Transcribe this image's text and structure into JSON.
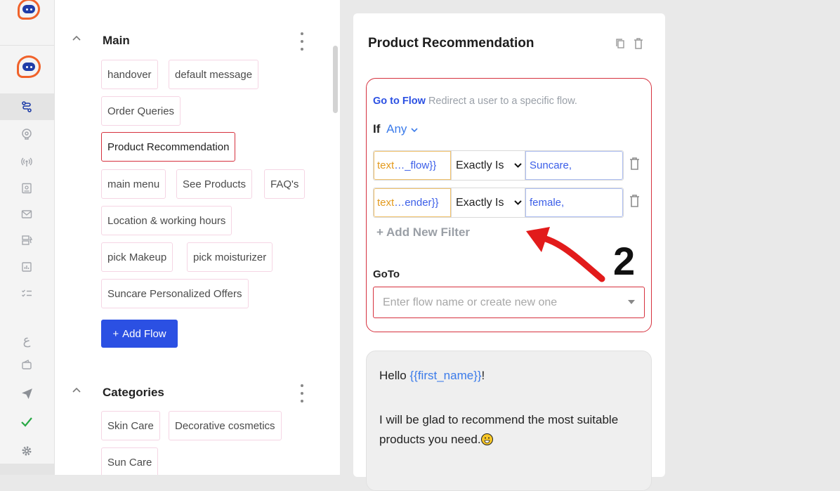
{
  "rail": {
    "items": [
      "logo-icon",
      "flows-icon",
      "brain-icon",
      "broadcast-icon",
      "contacts-icon",
      "mail-icon",
      "templates-icon",
      "analytics-icon",
      "checklist-icon",
      "arabic-icon",
      "wallet-icon",
      "send-icon",
      "check-icon",
      "settings-icon"
    ],
    "arabic_glyph": "ع"
  },
  "groups": [
    {
      "title": "Main",
      "chips": [
        "handover",
        "default message",
        "Order Queries",
        "Product Recommendation",
        "main menu",
        "See Products",
        "FAQ's",
        "Location & working hours",
        "pick Makeup",
        "pick moisturizer",
        "Suncare Personalized Offers"
      ],
      "selected": "Product Recommendation"
    },
    {
      "title": "Categories",
      "chips": [
        "Skin Care",
        "Decorative cosmetics",
        "Sun Care"
      ]
    }
  ],
  "add_flow_label": "Add Flow",
  "add_flow_plus": "+",
  "card": {
    "title": "Product Recommendation",
    "goto": {
      "name": "Go to Flow",
      "description": "Redirect a user to a specific flow.",
      "if_label": "If",
      "condition": "Any",
      "filters": [
        {
          "field_prefix": "text",
          "field_var": " …_flow}}",
          "operator": "Exactly Is",
          "value": "Suncare,"
        },
        {
          "field_prefix": "text",
          "field_var": "…ender}}",
          "operator": "Exactly Is",
          "value": "female,"
        }
      ],
      "add_filter_label": "Add New Filter",
      "add_filter_plus": "+",
      "goto_label": "GoTo",
      "goto_placeholder": "Enter flow name or create new one"
    },
    "message": {
      "greeting_prefix": "Hello ",
      "greeting_var": "{{first_name}}",
      "greeting_suffix": "!",
      "body": "I will be glad to recommend the most suitable products you need."
    }
  },
  "annotation": {
    "step_number": "2",
    "color": "#e21b1b"
  },
  "colors": {
    "accent": "#2b50e3",
    "danger": "#d6313e",
    "brand": "#f0622a"
  }
}
